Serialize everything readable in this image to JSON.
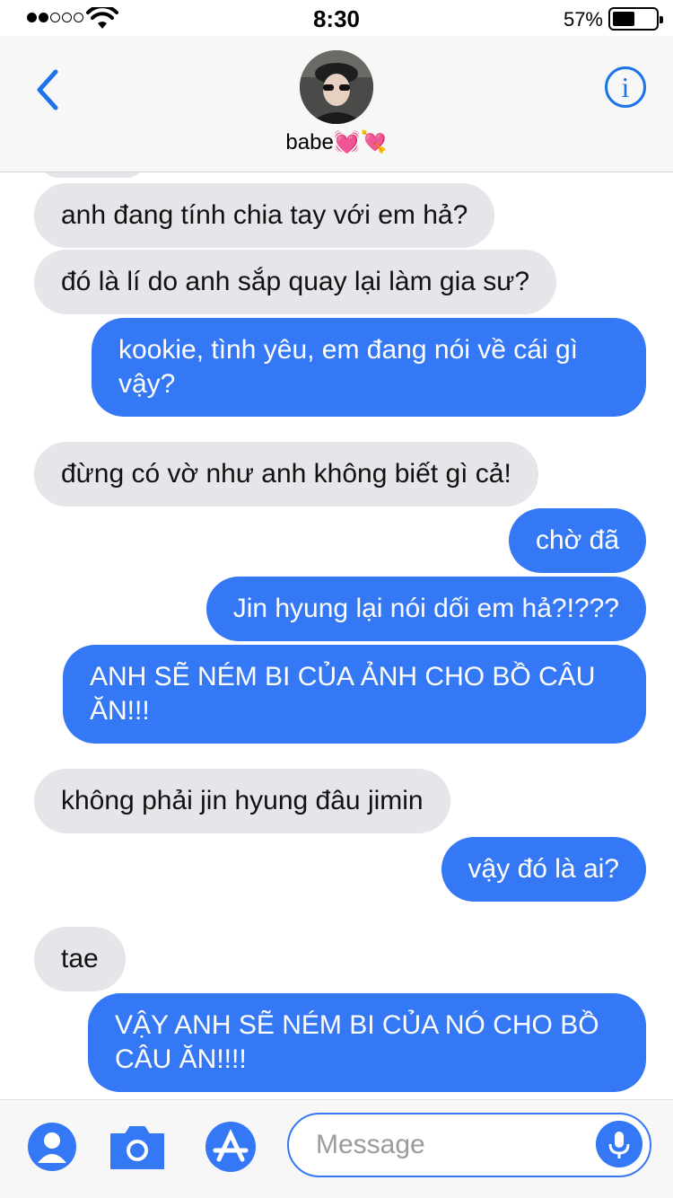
{
  "status_bar": {
    "time": "8:30",
    "battery": "57%",
    "battery_level": 0.57,
    "signal_bars_filled": 2,
    "signal_bars_total": 5
  },
  "header": {
    "contact_name": "babe",
    "contact_emoji": "💓💘",
    "back_icon": "chevron-left-icon",
    "info_icon": "info-icon"
  },
  "messages": [
    {
      "from": "them",
      "text": "anh đang tính chia tay với em hả?"
    },
    {
      "from": "them",
      "text": "đó là lí do anh sắp quay lại làm gia sư?"
    },
    {
      "from": "me",
      "text": "kookie, tình yêu, em đang nói về cái gì vậy?"
    },
    {
      "from": "them",
      "text": "đừng có vờ như anh không biết gì cả!"
    },
    {
      "from": "me",
      "text": "chờ đã"
    },
    {
      "from": "me",
      "text": "Jin hyung lại nói dối em hả?!???"
    },
    {
      "from": "me",
      "text": "ANH SẼ NÉM BI CỦA ẢNH CHO BỒ CÂU ĂN!!!"
    },
    {
      "from": "them",
      "text": "không phải jin hyung đâu jimin"
    },
    {
      "from": "me",
      "text": "vậy đó là ai?"
    },
    {
      "from": "them",
      "text": "tae"
    },
    {
      "from": "me",
      "text": "VẬY ANH SẼ NÉM BI CỦA NÓ CHO BỒ CÂU ĂN!!!!"
    }
  ],
  "composer": {
    "placeholder": "Message",
    "value": "",
    "icons": [
      "contact-icon",
      "camera-icon",
      "app-store-icon",
      "microphone-icon"
    ]
  },
  "colors": {
    "accent": "#3578f6",
    "incoming_bubble": "#e5e5ea",
    "header_bg": "#f7f7f7"
  }
}
